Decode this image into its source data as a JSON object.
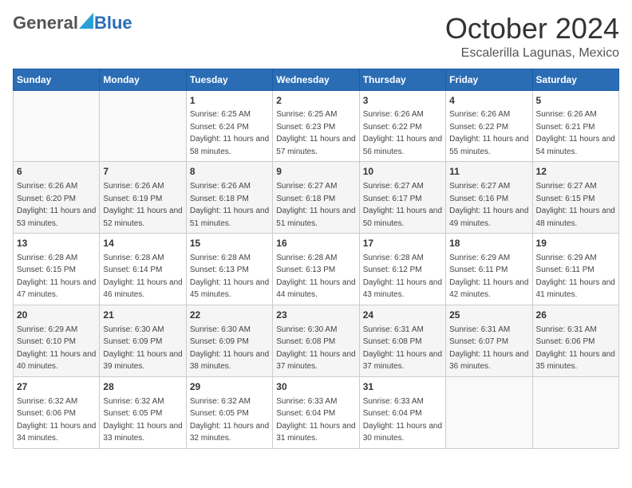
{
  "logo": {
    "general": "General",
    "blue": "Blue"
  },
  "header": {
    "month": "October 2024",
    "location": "Escalerilla Lagunas, Mexico"
  },
  "weekdays": [
    "Sunday",
    "Monday",
    "Tuesday",
    "Wednesday",
    "Thursday",
    "Friday",
    "Saturday"
  ],
  "weeks": [
    [
      {
        "day": "",
        "sunrise": "",
        "sunset": "",
        "daylight": ""
      },
      {
        "day": "",
        "sunrise": "",
        "sunset": "",
        "daylight": ""
      },
      {
        "day": "1",
        "sunrise": "Sunrise: 6:25 AM",
        "sunset": "Sunset: 6:24 PM",
        "daylight": "Daylight: 11 hours and 58 minutes."
      },
      {
        "day": "2",
        "sunrise": "Sunrise: 6:25 AM",
        "sunset": "Sunset: 6:23 PM",
        "daylight": "Daylight: 11 hours and 57 minutes."
      },
      {
        "day": "3",
        "sunrise": "Sunrise: 6:26 AM",
        "sunset": "Sunset: 6:22 PM",
        "daylight": "Daylight: 11 hours and 56 minutes."
      },
      {
        "day": "4",
        "sunrise": "Sunrise: 6:26 AM",
        "sunset": "Sunset: 6:22 PM",
        "daylight": "Daylight: 11 hours and 55 minutes."
      },
      {
        "day": "5",
        "sunrise": "Sunrise: 6:26 AM",
        "sunset": "Sunset: 6:21 PM",
        "daylight": "Daylight: 11 hours and 54 minutes."
      }
    ],
    [
      {
        "day": "6",
        "sunrise": "Sunrise: 6:26 AM",
        "sunset": "Sunset: 6:20 PM",
        "daylight": "Daylight: 11 hours and 53 minutes."
      },
      {
        "day": "7",
        "sunrise": "Sunrise: 6:26 AM",
        "sunset": "Sunset: 6:19 PM",
        "daylight": "Daylight: 11 hours and 52 minutes."
      },
      {
        "day": "8",
        "sunrise": "Sunrise: 6:26 AM",
        "sunset": "Sunset: 6:18 PM",
        "daylight": "Daylight: 11 hours and 51 minutes."
      },
      {
        "day": "9",
        "sunrise": "Sunrise: 6:27 AM",
        "sunset": "Sunset: 6:18 PM",
        "daylight": "Daylight: 11 hours and 51 minutes."
      },
      {
        "day": "10",
        "sunrise": "Sunrise: 6:27 AM",
        "sunset": "Sunset: 6:17 PM",
        "daylight": "Daylight: 11 hours and 50 minutes."
      },
      {
        "day": "11",
        "sunrise": "Sunrise: 6:27 AM",
        "sunset": "Sunset: 6:16 PM",
        "daylight": "Daylight: 11 hours and 49 minutes."
      },
      {
        "day": "12",
        "sunrise": "Sunrise: 6:27 AM",
        "sunset": "Sunset: 6:15 PM",
        "daylight": "Daylight: 11 hours and 48 minutes."
      }
    ],
    [
      {
        "day": "13",
        "sunrise": "Sunrise: 6:28 AM",
        "sunset": "Sunset: 6:15 PM",
        "daylight": "Daylight: 11 hours and 47 minutes."
      },
      {
        "day": "14",
        "sunrise": "Sunrise: 6:28 AM",
        "sunset": "Sunset: 6:14 PM",
        "daylight": "Daylight: 11 hours and 46 minutes."
      },
      {
        "day": "15",
        "sunrise": "Sunrise: 6:28 AM",
        "sunset": "Sunset: 6:13 PM",
        "daylight": "Daylight: 11 hours and 45 minutes."
      },
      {
        "day": "16",
        "sunrise": "Sunrise: 6:28 AM",
        "sunset": "Sunset: 6:13 PM",
        "daylight": "Daylight: 11 hours and 44 minutes."
      },
      {
        "day": "17",
        "sunrise": "Sunrise: 6:28 AM",
        "sunset": "Sunset: 6:12 PM",
        "daylight": "Daylight: 11 hours and 43 minutes."
      },
      {
        "day": "18",
        "sunrise": "Sunrise: 6:29 AM",
        "sunset": "Sunset: 6:11 PM",
        "daylight": "Daylight: 11 hours and 42 minutes."
      },
      {
        "day": "19",
        "sunrise": "Sunrise: 6:29 AM",
        "sunset": "Sunset: 6:11 PM",
        "daylight": "Daylight: 11 hours and 41 minutes."
      }
    ],
    [
      {
        "day": "20",
        "sunrise": "Sunrise: 6:29 AM",
        "sunset": "Sunset: 6:10 PM",
        "daylight": "Daylight: 11 hours and 40 minutes."
      },
      {
        "day": "21",
        "sunrise": "Sunrise: 6:30 AM",
        "sunset": "Sunset: 6:09 PM",
        "daylight": "Daylight: 11 hours and 39 minutes."
      },
      {
        "day": "22",
        "sunrise": "Sunrise: 6:30 AM",
        "sunset": "Sunset: 6:09 PM",
        "daylight": "Daylight: 11 hours and 38 minutes."
      },
      {
        "day": "23",
        "sunrise": "Sunrise: 6:30 AM",
        "sunset": "Sunset: 6:08 PM",
        "daylight": "Daylight: 11 hours and 37 minutes."
      },
      {
        "day": "24",
        "sunrise": "Sunrise: 6:31 AM",
        "sunset": "Sunset: 6:08 PM",
        "daylight": "Daylight: 11 hours and 37 minutes."
      },
      {
        "day": "25",
        "sunrise": "Sunrise: 6:31 AM",
        "sunset": "Sunset: 6:07 PM",
        "daylight": "Daylight: 11 hours and 36 minutes."
      },
      {
        "day": "26",
        "sunrise": "Sunrise: 6:31 AM",
        "sunset": "Sunset: 6:06 PM",
        "daylight": "Daylight: 11 hours and 35 minutes."
      }
    ],
    [
      {
        "day": "27",
        "sunrise": "Sunrise: 6:32 AM",
        "sunset": "Sunset: 6:06 PM",
        "daylight": "Daylight: 11 hours and 34 minutes."
      },
      {
        "day": "28",
        "sunrise": "Sunrise: 6:32 AM",
        "sunset": "Sunset: 6:05 PM",
        "daylight": "Daylight: 11 hours and 33 minutes."
      },
      {
        "day": "29",
        "sunrise": "Sunrise: 6:32 AM",
        "sunset": "Sunset: 6:05 PM",
        "daylight": "Daylight: 11 hours and 32 minutes."
      },
      {
        "day": "30",
        "sunrise": "Sunrise: 6:33 AM",
        "sunset": "Sunset: 6:04 PM",
        "daylight": "Daylight: 11 hours and 31 minutes."
      },
      {
        "day": "31",
        "sunrise": "Sunrise: 6:33 AM",
        "sunset": "Sunset: 6:04 PM",
        "daylight": "Daylight: 11 hours and 30 minutes."
      },
      {
        "day": "",
        "sunrise": "",
        "sunset": "",
        "daylight": ""
      },
      {
        "day": "",
        "sunrise": "",
        "sunset": "",
        "daylight": ""
      }
    ]
  ]
}
